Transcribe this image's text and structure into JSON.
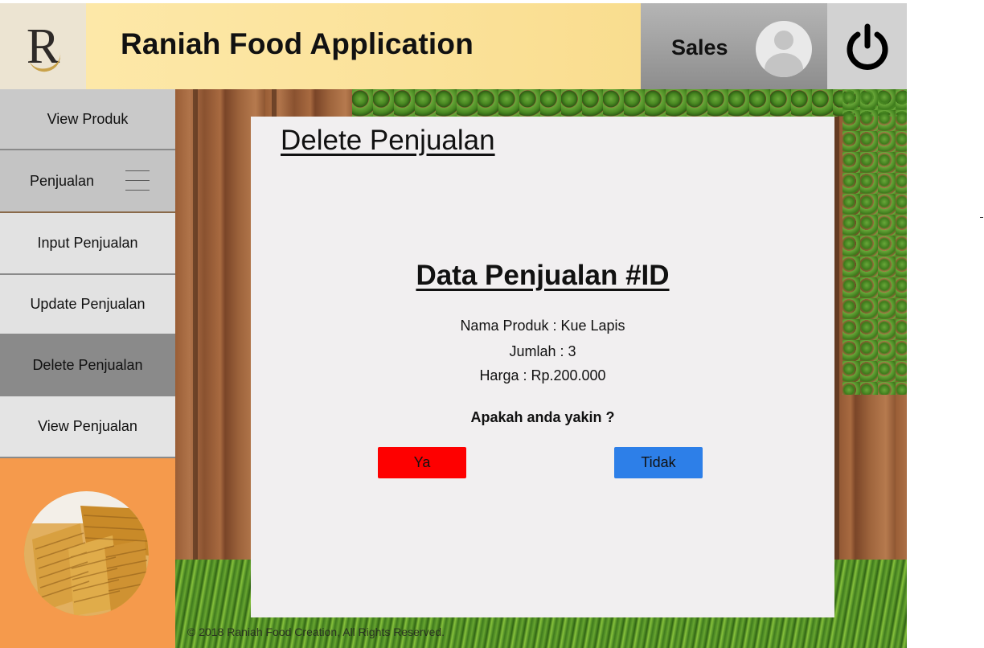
{
  "header": {
    "logo_letter": "R",
    "app_title": "Raniah Food Application",
    "role": "Sales",
    "icons": {
      "avatar": "user-avatar-icon",
      "power": "power-icon"
    }
  },
  "sidebar": {
    "items": [
      {
        "label": "View Produk"
      },
      {
        "label": "Penjualan"
      },
      {
        "label": "Input Penjualan"
      },
      {
        "label": "Update Penjualan"
      },
      {
        "label": "Delete Penjualan"
      },
      {
        "label": "View Penjualan"
      }
    ],
    "active_item": "Delete Penjualan",
    "icons": {
      "menu": "hamburger-menu-icon"
    }
  },
  "main": {
    "page_title": "Delete Penjualan",
    "record_title": "Data Penjualan #ID",
    "details": {
      "nama_produk": "Nama Produk : Kue Lapis",
      "jumlah": "Jumlah : 3",
      "harga": "Harga : Rp.200.000"
    },
    "confirm_text": "Apakah anda yakin ?",
    "buttons": {
      "yes": "Ya",
      "no": "Tidak"
    }
  },
  "footer": {
    "copyright": "© 2018 Raniah Food Creation, All Rights Reserved."
  },
  "colors": {
    "header_gold": "#fbe29a",
    "sidebar_orange": "#f59a4c",
    "active_menu": "#8a8a8a",
    "button_yes": "#fe0000",
    "button_no": "#2d7fe8",
    "card_bg": "#f1eff0"
  }
}
